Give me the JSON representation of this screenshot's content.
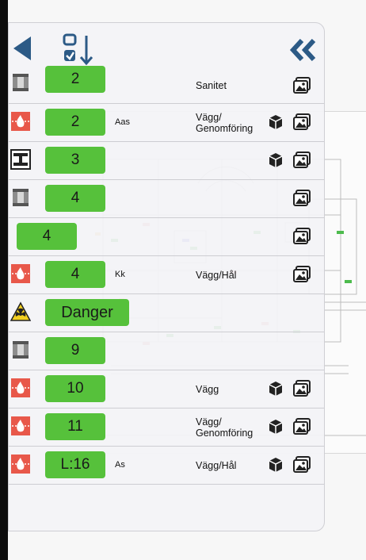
{
  "toolbar": {
    "back_icon": "back-triangle-icon",
    "sort_icon": "checklist-sort-icon",
    "collapse_icon": "double-chevron-left-icon",
    "accent_color": "#2c5a86"
  },
  "pill_color": "#56c13b",
  "rows": [
    {
      "icon": "wall-section-icon",
      "label": "2",
      "short": "",
      "type": [
        "Sanitet"
      ],
      "cube": false,
      "photo": true
    },
    {
      "icon": "fire-wall-penetration-icon",
      "label": "2",
      "short": "Aas",
      "type": [
        "Vägg/",
        "Genomföring"
      ],
      "cube": true,
      "photo": true
    },
    {
      "icon": "beam-section-icon",
      "label": "3",
      "short": "",
      "type": [],
      "cube": true,
      "photo": true
    },
    {
      "icon": "wall-section-icon",
      "label": "4",
      "short": "",
      "type": [],
      "cube": false,
      "photo": true
    },
    {
      "icon": "",
      "label": "4",
      "short": "",
      "type": [],
      "cube": false,
      "photo": true
    },
    {
      "icon": "fire-wall-penetration-icon",
      "label": "4",
      "short": "Kk",
      "type": [
        "Vägg/Hål"
      ],
      "cube": false,
      "photo": true
    },
    {
      "icon": "radiation-warning-icon",
      "label": "Danger",
      "short": "",
      "type": [],
      "cube": false,
      "photo": false
    },
    {
      "icon": "wall-section-icon",
      "label": "9",
      "short": "",
      "type": [],
      "cube": false,
      "photo": false
    },
    {
      "icon": "fire-wall-penetration-icon",
      "label": "10",
      "short": "",
      "type": [
        "Vägg"
      ],
      "cube": true,
      "photo": true
    },
    {
      "icon": "fire-wall-penetration-icon",
      "label": "11",
      "short": "",
      "type": [
        "Vägg/",
        "Genomföring"
      ],
      "cube": true,
      "photo": true
    },
    {
      "icon": "fire-wall-penetration-icon",
      "label": "L:16",
      "short": "As",
      "type": [
        "Vägg/Hål"
      ],
      "cube": true,
      "photo": true
    }
  ]
}
